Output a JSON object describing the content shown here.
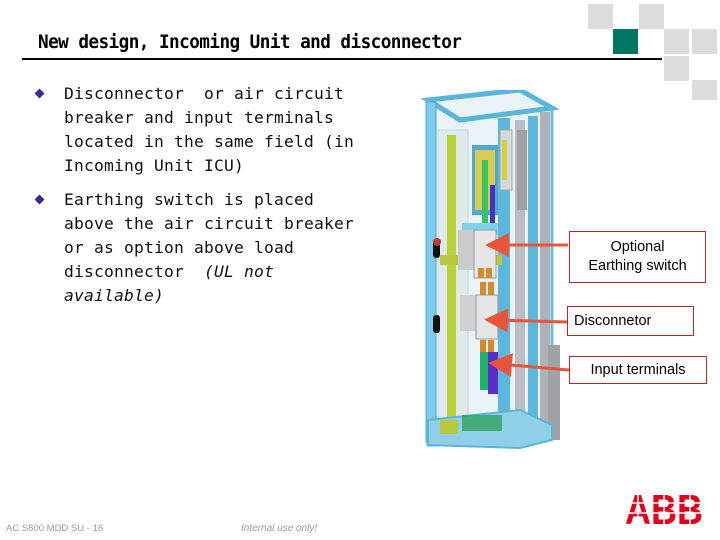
{
  "slide": {
    "title": "New design, Incoming Unit and disconnector",
    "bullets": [
      {
        "text": "Disconnector  or air circuit\nbreaker and input terminals\nlocated in the same field (in\nIncoming Unit ICU)",
        "italic_suffix": ""
      },
      {
        "text": "Earthing switch is placed\nabove the air circuit breaker\nor as option above load\ndisconnector  ",
        "italic_suffix": "(UL not\navailable)"
      }
    ],
    "callouts": [
      {
        "id": "optional-earthing-switch",
        "label": "Optional\nEarthing switch"
      },
      {
        "id": "disconnector",
        "label": "Disconnetor"
      },
      {
        "id": "input-terminals",
        "label": "Input terminals"
      }
    ],
    "illustration": {
      "description": "cabinet-3d-render"
    },
    "footer": {
      "doc_id": "AC S800 MDD SU  - 16",
      "confidentiality": "Internal use only!"
    },
    "logo": {
      "text": "ABB"
    }
  },
  "colors": {
    "accent_teal": "#007563",
    "deco_gray": "#dcdcdc",
    "bullet": "#3b2a9b",
    "callout_border": "#b22a2a",
    "arrow": "#e8553a",
    "logo_red": "#e2001a",
    "footer_text": "#9a9a9a"
  }
}
